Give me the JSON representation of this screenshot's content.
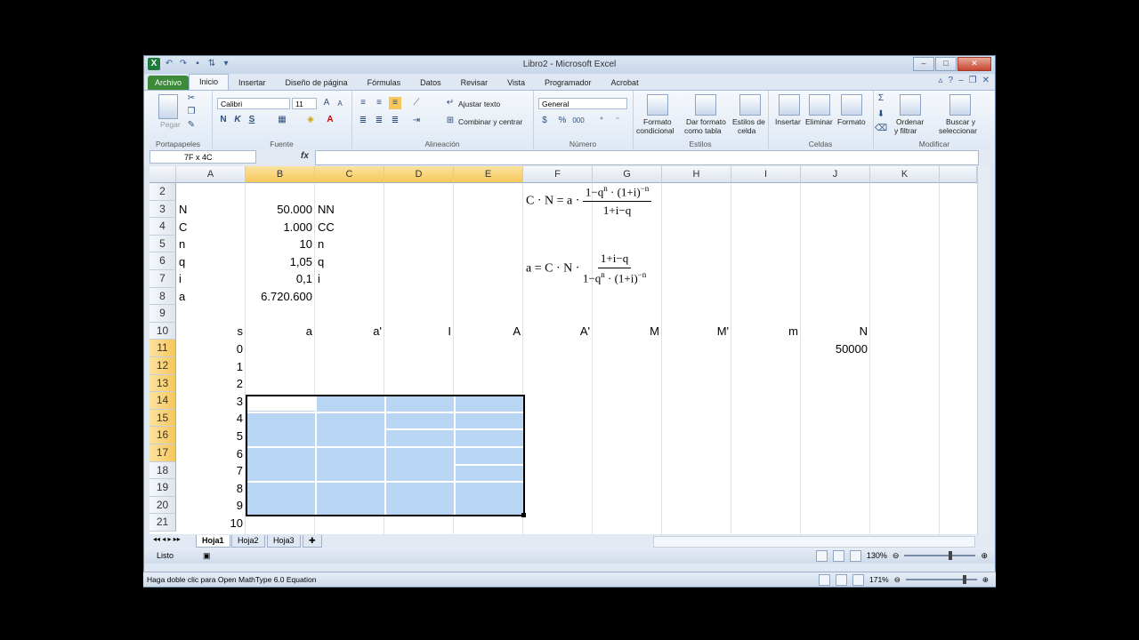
{
  "window": {
    "title": "Libro2 - Microsoft Excel",
    "controls": [
      "–",
      "□",
      "✕"
    ]
  },
  "ribbon": {
    "tabs": [
      "Archivo",
      "Inicio",
      "Insertar",
      "Diseño de página",
      "Fórmulas",
      "Datos",
      "Revisar",
      "Vista",
      "Programador",
      "Acrobat"
    ],
    "groups": {
      "clipboard": {
        "label": "Portapapeles",
        "paste": "Pegar"
      },
      "font": {
        "label": "Fuente",
        "name": "Calibri",
        "size": "11",
        "bold": "N",
        "italic": "K",
        "underline": "S"
      },
      "alignment": {
        "label": "Alineación",
        "wrap": "Ajustar texto",
        "merge": "Combinar y centrar"
      },
      "number": {
        "label": "Número",
        "format": "General",
        "percent": "%",
        "thousands": "000"
      },
      "styles": {
        "label": "Estilos",
        "cond1": "Formato",
        "cond2": "condicional",
        "table1": "Dar formato",
        "table2": "como tabla",
        "cell1": "Estilos de",
        "cell2": "celda"
      },
      "cells": {
        "label": "Celdas",
        "insert": "Insertar",
        "delete": "Eliminar",
        "format": "Formato"
      },
      "editing": {
        "label": "Modificar",
        "sort1": "Ordenar",
        "sort2": "y filtrar",
        "find1": "Buscar y",
        "find2": "seleccionar"
      }
    }
  },
  "formula_bar": {
    "name_box": "7F x 4C",
    "fx": "fx"
  },
  "grid": {
    "columns": [
      "A",
      "B",
      "C",
      "D",
      "E",
      "F",
      "G",
      "H",
      "I",
      "J",
      "K"
    ],
    "rows": [
      "2",
      "3",
      "4",
      "5",
      "6",
      "7",
      "8",
      "9",
      "10",
      "11",
      "12",
      "13",
      "14",
      "15",
      "16",
      "17",
      "18",
      "19",
      "20",
      "21"
    ],
    "params": [
      {
        "a": "N",
        "b": "50.000",
        "c": "NN"
      },
      {
        "a": "C",
        "b": "1.000",
        "c": "CC"
      },
      {
        "a": "n",
        "b": "10",
        "c": "n"
      },
      {
        "a": "q",
        "b": "1,05",
        "c": "q"
      },
      {
        "a": "i",
        "b": "0,1",
        "c": "i"
      },
      {
        "a": "a",
        "b": "6.720.600",
        "c": ""
      }
    ],
    "headers_row10": [
      "s",
      "a",
      "a'",
      "I",
      "A",
      "A'",
      "M",
      "M'",
      "m",
      "N"
    ],
    "s_values": [
      "0",
      "1",
      "2",
      "3",
      "4",
      "5",
      "6",
      "7",
      "8",
      "9",
      "10"
    ],
    "j11": "50000"
  },
  "equations": {
    "eq1_left": "C · N = a ·",
    "eq1_num": "1−q",
    "eq1_num_sup": "n",
    "eq1_num_rest": " · (1+i)",
    "eq1_num_sup2": "−n",
    "eq1_den": "1+i−q",
    "eq2_left": "a = C · N ·",
    "eq2_num": "1+i−q",
    "eq2_den": "1−q",
    "eq2_den_sup": "n",
    "eq2_den_rest": " · (1+i)",
    "eq2_den_sup2": "−n"
  },
  "sheets": [
    "Hoja1",
    "Hoja2",
    "Hoja3"
  ],
  "status": {
    "ready": "Listo",
    "zoom": "130%"
  },
  "status2": {
    "text": "Haga doble clic para Open MathType 6.0 Equation",
    "zoom": "171%"
  }
}
